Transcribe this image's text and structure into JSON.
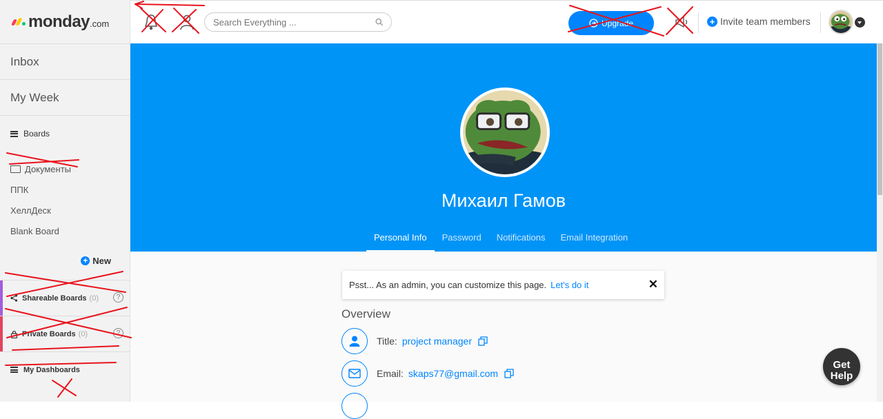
{
  "brand": {
    "name": "monday",
    "suffix": ".com",
    "dot_colors": [
      "#ff3d57",
      "#ffcb00",
      "#00ca72"
    ]
  },
  "sidebar": {
    "inbox": "Inbox",
    "my_week": "My Week",
    "boards_label": "Boards",
    "boards": [
      {
        "label": "Документы"
      },
      {
        "label": "ППК"
      },
      {
        "label": "ХеллДеск"
      },
      {
        "label": "Blank Board"
      }
    ],
    "new_label": "New",
    "sections": [
      {
        "label": "Shareable Boards",
        "count": "(0)",
        "help": "?",
        "accent": "#a25ddc"
      },
      {
        "label": "Private Boards",
        "count": "(0)",
        "help": "?",
        "accent": "#e2445c"
      },
      {
        "label": "My Dashboards"
      }
    ]
  },
  "topbar": {
    "search_placeholder": "Search Everything ...",
    "upgrade_label": "Upgrade",
    "invite_label": "Invite team members"
  },
  "profile": {
    "name": "Михаил Гамов",
    "tabs": [
      {
        "label": "Personal Info",
        "active": true
      },
      {
        "label": "Password"
      },
      {
        "label": "Notifications"
      },
      {
        "label": "Email Integration"
      }
    ],
    "notice": {
      "text": "Psst... As an admin, you can customize this page.",
      "link": "Let's do it",
      "close": "✕"
    },
    "overview_label": "Overview",
    "fields": [
      {
        "label": "Title:",
        "value": "project manager",
        "icon": "person-icon"
      },
      {
        "label": "Email:",
        "value": "skaps77@gmail.com",
        "icon": "envelope-icon"
      }
    ]
  },
  "help": {
    "line1": "Get",
    "line2": "Help"
  },
  "colors": {
    "accent": "#0085ff",
    "banner": "#0094f7",
    "annotation_red": "#e8141c"
  }
}
